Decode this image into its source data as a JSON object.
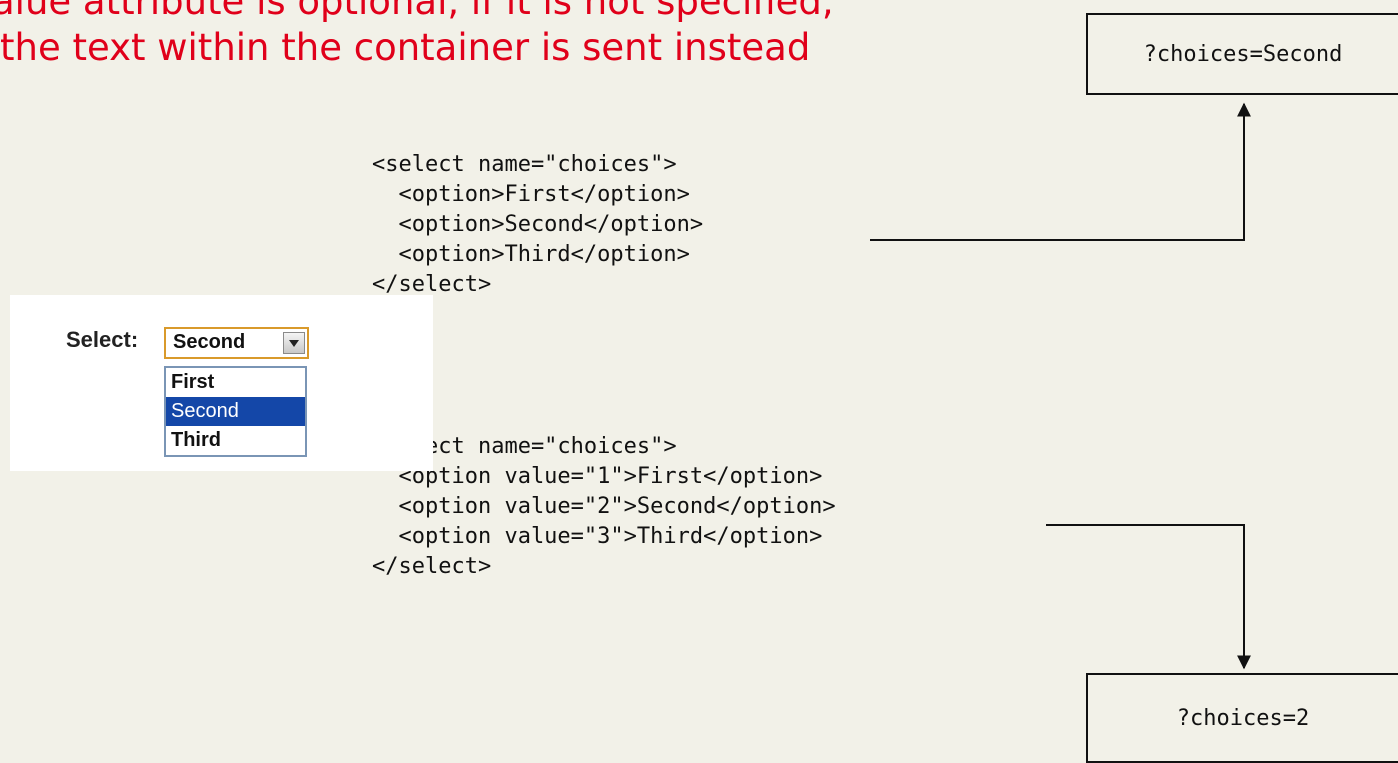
{
  "heading": {
    "line1": "alue attribute is optional, if it is not specified,",
    "line2": "the text within the container is sent instead"
  },
  "colors": {
    "heading": "#e0001a",
    "background": "#f2f1e8",
    "selected_option": "#1447a8",
    "select_border": "#d99a2b"
  },
  "example1": {
    "code": [
      "<select name=\"choices\">",
      "  <option>First</option>",
      "  <option>Second</option>",
      "  <option>Third</option>",
      "</select>"
    ],
    "result": "?choices=Second"
  },
  "example2": {
    "code": [
      "<select name=\"choices\">",
      "  <option value=\"1\">First</option>",
      "  <option value=\"2\">Second</option>",
      "  <option value=\"3\">Third</option>",
      "</select>"
    ],
    "result": "?choices=2"
  },
  "demo": {
    "label": "Select:",
    "selected": "Second",
    "dropdown_icon": "triangle-down-icon",
    "options": [
      "First",
      "Second",
      "Third"
    ],
    "highlighted_index": 1
  }
}
